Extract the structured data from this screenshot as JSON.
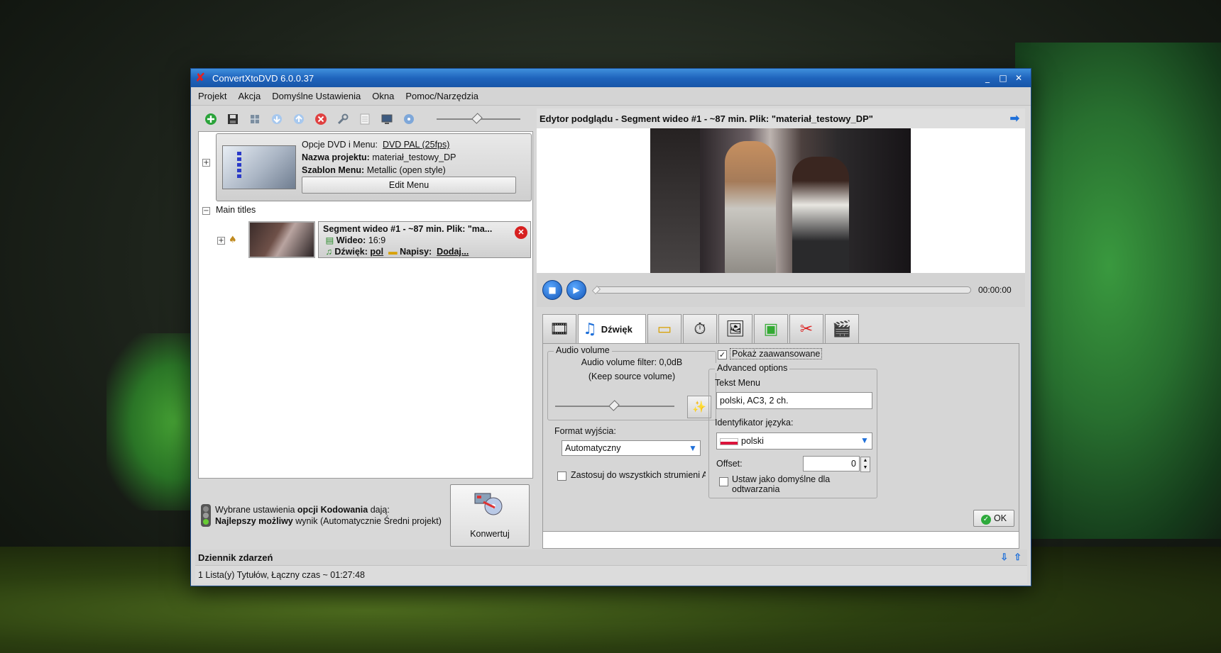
{
  "window": {
    "title": "ConvertXtoDVD 6.0.0.37",
    "controls": [
      "_",
      "□",
      "✕"
    ]
  },
  "menu": [
    "Projekt",
    "Akcja",
    "Domyślne Ustawienia",
    "Okna",
    "Pomoc/Narzędzia"
  ],
  "toolbar": {
    "icons": [
      "add-icon",
      "save-icon",
      "settings-icon",
      "move-down-icon",
      "move-up-icon",
      "delete-icon",
      "tools-icon",
      "list-icon",
      "monitor-icon",
      "disc-icon"
    ]
  },
  "project": {
    "dvd_options_label": "Opcje DVD i Menu:",
    "dvd_options_value": "DVD PAL (25fps)",
    "name_label": "Nazwa projektu:",
    "name_value": "materiał_testowy_DP",
    "template_label": "Szablon Menu:",
    "template_value": "Metallic (open style)",
    "edit_menu_button": "Edit Menu"
  },
  "tree": {
    "main_titles": "Main titles",
    "segment": {
      "title": "Segment wideo #1 - ~87 min. Plik: \"ma...",
      "video_label": "Wideo:",
      "video_value": "16:9",
      "audio_label": "Dźwięk:",
      "audio_value": "pol",
      "subs_label": "Napisy:",
      "subs_value": "Dodaj..."
    }
  },
  "encoding_status": {
    "line1_prefix": "Wybrane ustawienia ",
    "line1_bold": "opcji Kodowania",
    "line1_suffix": " dają:",
    "line2_bold": "Najlepszy możliwy",
    "line2_suffix": " wynik (Automatycznie Średni projekt)",
    "convert_button": "Konwertuj"
  },
  "preview": {
    "header": "Edytor podglądu - Segment wideo #1 - ~87 min. Plik: \"materiał_testowy_DP\"",
    "time": "00:00:00"
  },
  "tabs": {
    "active_label": "Dźwięk"
  },
  "audio": {
    "group_title": "Audio volume",
    "filter_text": "Audio volume filter: 0,0dB",
    "keep_text": "(Keep source volume)",
    "volume_level": 0.5,
    "format_label": "Format wyjścia:",
    "format_value": "Automatyczny",
    "apply_all_label": "Zastosuj do wszystkich strumieni Audio",
    "show_advanced_label": "Pokaż zaawansowane",
    "show_advanced_checked": true
  },
  "advanced": {
    "group_title": "Advanced options",
    "menu_text_label": "Tekst Menu",
    "menu_text_value": "polski, AC3, 2 ch.",
    "lang_label": "Identyfikator języka:",
    "lang_value": "polski",
    "offset_label": "Offset:",
    "offset_value": "0",
    "default_label_1": "Ustaw jako domyślne dla",
    "default_label_2": "odtwarzania",
    "ok_button": "OK"
  },
  "log": {
    "title": "Dziennik zdarzeń",
    "status": "1 Lista(y) Tytułów, Łączny czas ~ 01:27:48"
  },
  "colors": {
    "titlebar": "#1f64bd",
    "accent": "#1e6fd9",
    "close_red": "#d72020"
  }
}
